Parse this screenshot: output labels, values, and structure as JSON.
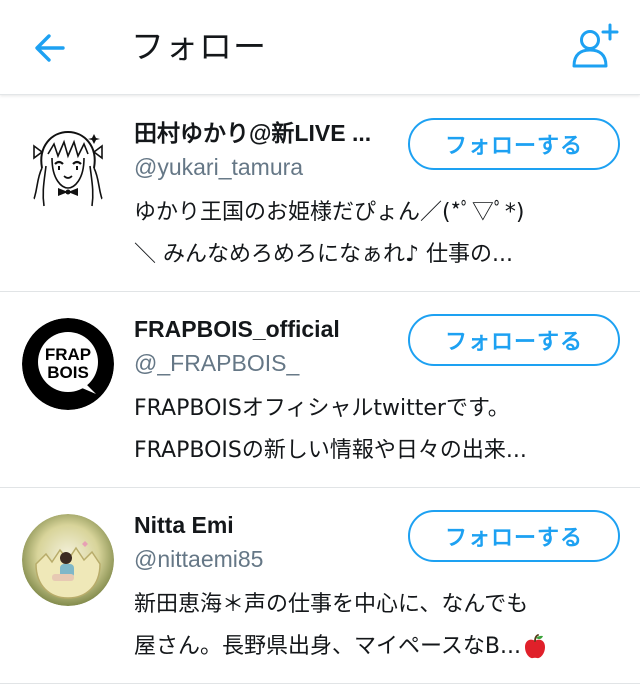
{
  "colors": {
    "accent": "#1da1f2",
    "text": "#14171a",
    "secondary_text": "#657786",
    "divider": "#e1e4e6"
  },
  "header": {
    "back_icon": "arrow-left-icon",
    "title": "フォロー",
    "add_user_icon": "add-user-icon"
  },
  "users": [
    {
      "name": "田村ゆかり@新LIVE ...",
      "handle": "@yukari_tamura",
      "bio_line1": "ゆかり王国のお姫様だぴょん／(*ﾟ▽ﾟ*)",
      "bio_line2": "＼ みんなめろめろになぁれ♪ 仕事の...",
      "follow_label": "フォローする",
      "avatar_icon": "anime-girl-sketch-avatar"
    },
    {
      "name": "FRAPBOIS_official",
      "handle": "@_FRAPBOIS_",
      "bio_line1": "FRAPBOISオフィシャルtwitterです。",
      "bio_line2": "FRAPBOISの新しい情報や日々の出来...",
      "follow_label": "フォローする",
      "avatar_logo_line1": "FRAP",
      "avatar_logo_line2": "BOIS"
    },
    {
      "name": "Nitta Emi",
      "handle": "@nittaemi85",
      "bio_line1": "新田恵海＊声の仕事を中心に、なんでも",
      "bio_line2": "屋さん。長野県出身、マイペースなB...",
      "follow_label": "フォローする",
      "avatar_icon": "photo-avatar",
      "bio_emoji": "red-apple-icon"
    }
  ]
}
